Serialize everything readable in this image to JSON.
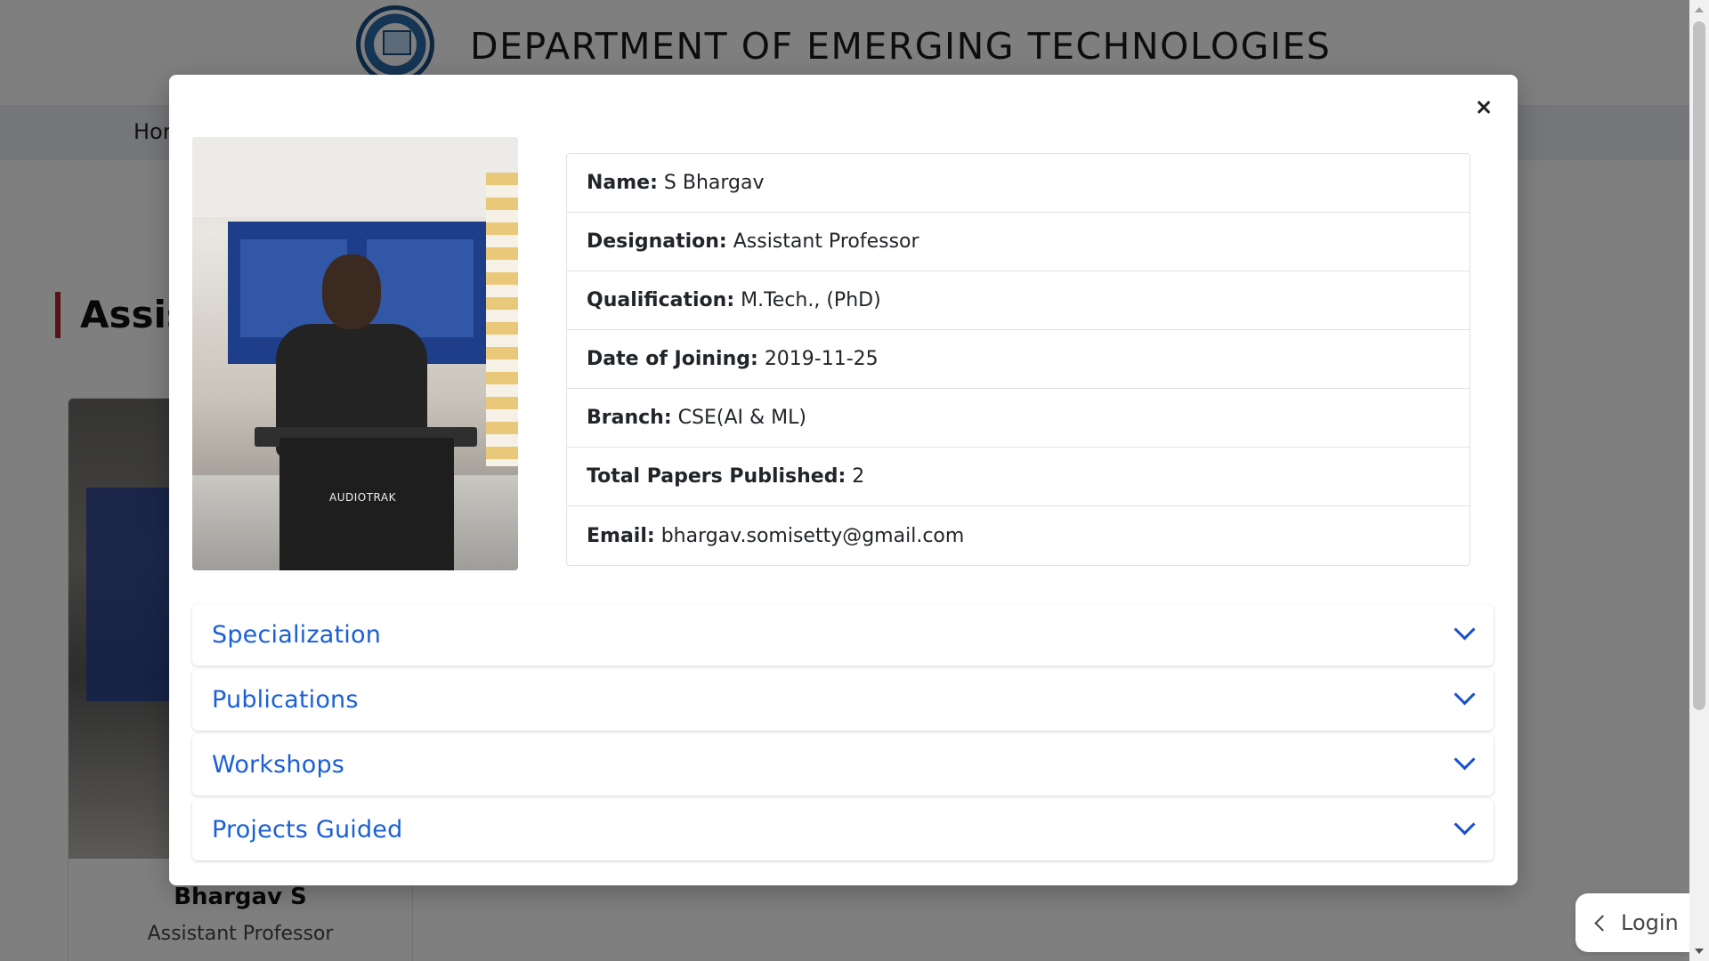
{
  "site": {
    "department_title": "DEPARTMENT OF EMERGING TECHNOLOGIES",
    "nav_home_partial": "Hor",
    "section_heading_partial": "Assist",
    "login_label": "Login"
  },
  "background_card": {
    "name": "Bhargav S",
    "role": "Assistant Professor"
  },
  "modal": {
    "photo_caption_brand": "AUDIOTRAK",
    "details": [
      {
        "label": "Name:",
        "value": "S Bhargav"
      },
      {
        "label": "Designation:",
        "value": "Assistant Professor"
      },
      {
        "label": "Qualification:",
        "value": "M.Tech., (PhD)"
      },
      {
        "label": "Date of Joining:",
        "value": "2019-11-25"
      },
      {
        "label": "Branch:",
        "value": "CSE(AI & ML)"
      },
      {
        "label": "Total Papers Published:",
        "value": "2"
      },
      {
        "label": "Email:",
        "value": "bhargav.somisetty@gmail.com"
      }
    ],
    "accordions": [
      {
        "title": "Specialization",
        "expanded": false
      },
      {
        "title": "Publications",
        "expanded": false
      },
      {
        "title": "Workshops",
        "expanded": false
      },
      {
        "title": "Projects Guided",
        "expanded": false
      }
    ]
  },
  "colors": {
    "accent_link": "#1a5fd6",
    "heading_bar": "#b0222e",
    "backdrop": "rgba(0,0,0,0.5)"
  },
  "icons": [
    "college-logo-icon",
    "close-icon",
    "chevron-down-icon",
    "chevron-left-icon"
  ]
}
